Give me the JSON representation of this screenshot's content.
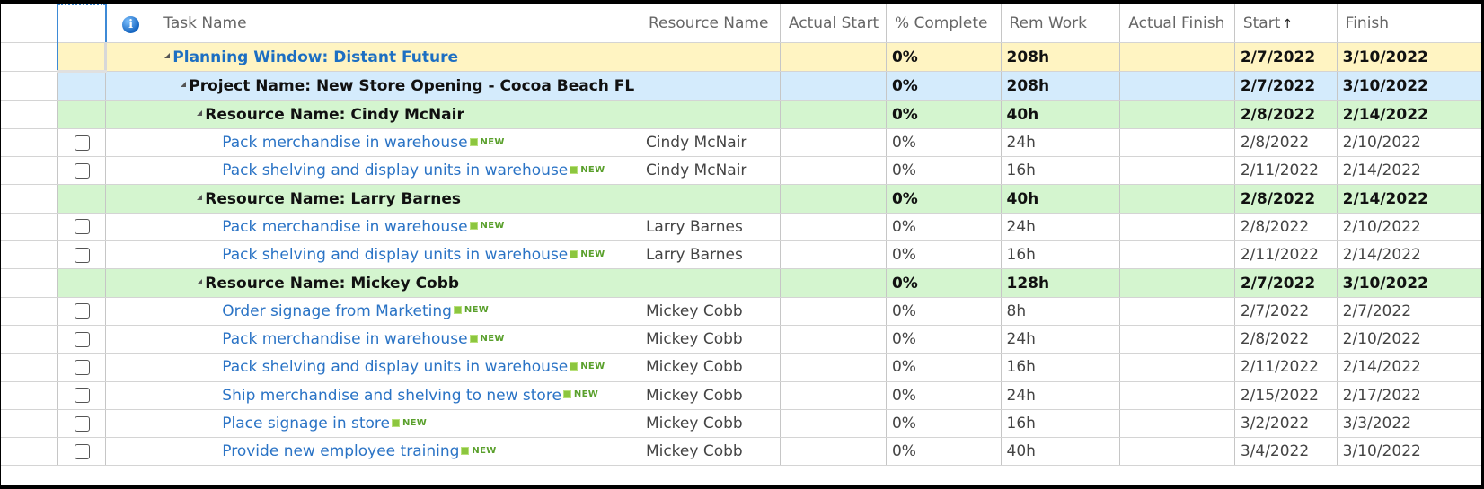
{
  "columns": {
    "indicator": "",
    "select": "",
    "info_icon": "info-icon",
    "task_name": "Task Name",
    "resource_name": "Resource Name",
    "actual_start": "Actual Start",
    "pct_complete": "% Complete",
    "rem_work": "Rem Work",
    "actual_finish": "Actual Finish",
    "start": "Start",
    "start_sort": "↑",
    "finish": "Finish"
  },
  "new_badge": "NEW",
  "groups": {
    "planning": {
      "title": "Planning Window: Distant Future",
      "pct": "0%",
      "rem": "208h",
      "start": "2/7/2022",
      "finish": "3/10/2022"
    },
    "project": {
      "title": "Project Name: New Store Opening - Cocoa Beach FL",
      "pct": "0%",
      "rem": "208h",
      "start": "2/7/2022",
      "finish": "3/10/2022"
    },
    "resources": [
      {
        "title": "Resource Name: Cindy McNair",
        "pct": "0%",
        "rem": "40h",
        "start": "2/8/2022",
        "finish": "2/14/2022",
        "tasks": [
          {
            "name": "Pack merchandise in warehouse",
            "resource": "Cindy McNair",
            "pct": "0%",
            "rem": "24h",
            "start": "2/8/2022",
            "finish": "2/10/2022"
          },
          {
            "name": "Pack shelving and display units in warehouse",
            "resource": "Cindy McNair",
            "pct": "0%",
            "rem": "16h",
            "start": "2/11/2022",
            "finish": "2/14/2022"
          }
        ]
      },
      {
        "title": "Resource Name: Larry Barnes",
        "pct": "0%",
        "rem": "40h",
        "start": "2/8/2022",
        "finish": "2/14/2022",
        "tasks": [
          {
            "name": "Pack merchandise in warehouse",
            "resource": "Larry Barnes",
            "pct": "0%",
            "rem": "24h",
            "start": "2/8/2022",
            "finish": "2/10/2022"
          },
          {
            "name": "Pack shelving and display units in warehouse",
            "resource": "Larry Barnes",
            "pct": "0%",
            "rem": "16h",
            "start": "2/11/2022",
            "finish": "2/14/2022"
          }
        ]
      },
      {
        "title": "Resource Name: Mickey Cobb",
        "pct": "0%",
        "rem": "128h",
        "start": "2/7/2022",
        "finish": "3/10/2022",
        "tasks": [
          {
            "name": "Order signage from Marketing",
            "resource": "Mickey Cobb",
            "pct": "0%",
            "rem": "8h",
            "start": "2/7/2022",
            "finish": "2/7/2022"
          },
          {
            "name": "Pack merchandise in warehouse",
            "resource": "Mickey Cobb",
            "pct": "0%",
            "rem": "24h",
            "start": "2/8/2022",
            "finish": "2/10/2022"
          },
          {
            "name": "Pack shelving and display units in warehouse",
            "resource": "Mickey Cobb",
            "pct": "0%",
            "rem": "16h",
            "start": "2/11/2022",
            "finish": "2/14/2022"
          },
          {
            "name": "Ship merchandise and shelving to new store",
            "resource": "Mickey Cobb",
            "pct": "0%",
            "rem": "24h",
            "start": "2/15/2022",
            "finish": "2/17/2022"
          },
          {
            "name": "Place signage in store",
            "resource": "Mickey Cobb",
            "pct": "0%",
            "rem": "16h",
            "start": "3/2/2022",
            "finish": "3/3/2022"
          },
          {
            "name": "Provide new employee training",
            "resource": "Mickey Cobb",
            "pct": "0%",
            "rem": "40h",
            "start": "3/4/2022",
            "finish": "3/10/2022"
          }
        ]
      }
    ]
  }
}
